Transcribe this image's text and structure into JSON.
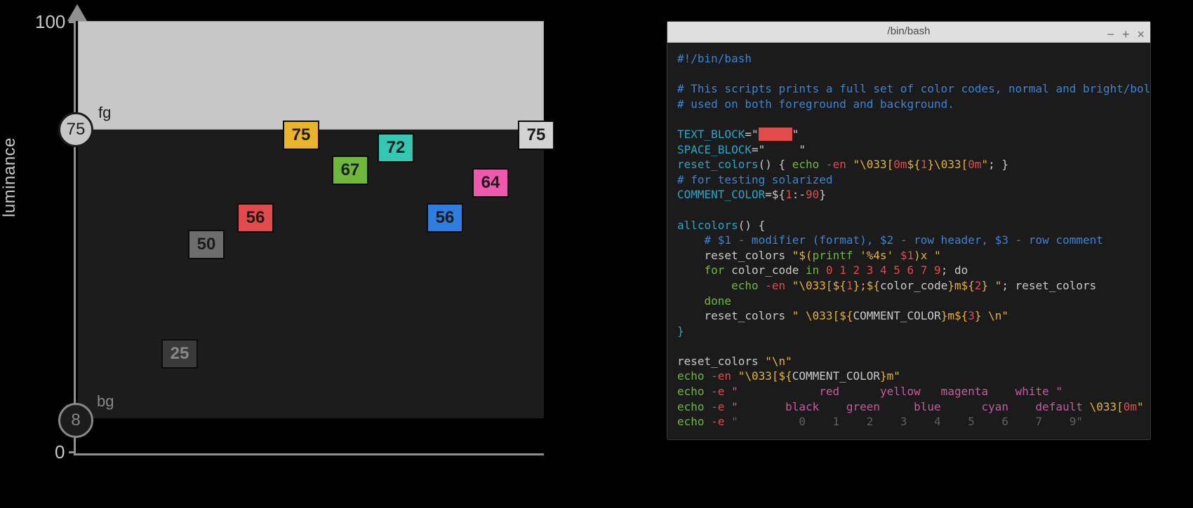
{
  "chart_data": {
    "type": "scatter",
    "title": "",
    "xlabel": "",
    "ylabel": "luminance",
    "ylim": [
      0,
      100
    ],
    "yticks": [
      0,
      100
    ],
    "fg_line": 75,
    "bg_line": 8,
    "points": [
      {
        "label": "25",
        "luminance": 25,
        "color": "#3a3a3a"
      },
      {
        "label": "50",
        "luminance": 50,
        "color": "#6d6d6d"
      },
      {
        "label": "56",
        "luminance": 56,
        "color": "#e24b4b"
      },
      {
        "label": "75",
        "luminance": 75,
        "color": "#e9b42c"
      },
      {
        "label": "67",
        "luminance": 67,
        "color": "#6db83a"
      },
      {
        "label": "72",
        "luminance": 72,
        "color": "#34c7b2"
      },
      {
        "label": "56",
        "luminance": 56,
        "color": "#2f7de0"
      },
      {
        "label": "64",
        "luminance": 64,
        "color": "#ee58ad"
      },
      {
        "label": "75",
        "luminance": 75,
        "color": "#d3d3d3"
      }
    ],
    "axis_labels": {
      "fg": "fg",
      "bg": "bg"
    },
    "axis_circle_values": {
      "fg": "75",
      "bg": "8"
    }
  },
  "terminal": {
    "title": "/bin/bash",
    "win_buttons": {
      "min": "−",
      "max": "+",
      "close": "×"
    },
    "code": {
      "shebang": "#!/bin/bash",
      "blank": "",
      "comment1": "# This scripts prints a full set of color codes, normal and bright/bold,",
      "comment2": "# used on both foreground and background.",
      "textblock_k": "TEXT_BLOCK",
      "textblock_v": "=\"",
      "textblock_fill": "▮▮▮▮▮",
      "textblock_end": "\"",
      "spaceblock_k": "SPACE_BLOCK",
      "spaceblock_v": "=\"     \"",
      "reset_fn": "reset_colors",
      "reset_body_a": "() { ",
      "reset_echo": "echo",
      "reset_flag": " -en ",
      "reset_str_a": "\"\\033[",
      "reset_zero_a": "0m",
      "reset_mid": "${",
      "reset_one": "1",
      "reset_mid2": "}\\033[",
      "reset_zero_b": "0m",
      "reset_str_b": "\"",
      "reset_tail": "; }",
      "comment3": "# for testing solarized",
      "ccolor_k": "COMMENT_COLOR",
      "ccolor_v": "=${",
      "ccolor_one": "1",
      "ccolor_def": ":-",
      "ccolor_num": "90",
      "ccolor_end": "}",
      "all_fn": "allcolors",
      "all_open": "() {",
      "all_c1": "    # $1 - modifier (format), $2 - row header, $3 - row comment",
      "all_l2_a": "    reset_colors ",
      "all_l2_q": "\"$(",
      "all_l2_printf": "printf",
      "all_l2_fmt": " '%4s' ",
      "all_l2_arg": "$1",
      "all_l2_tail": ")x \"",
      "all_for": "    for",
      "all_for_var": " color_code ",
      "all_in": "in",
      "all_nums": " 0 1 2 3 4 5 6 7 9",
      "all_for_tail": "; do",
      "all_echo_ind": "        ",
      "all_echo": "echo",
      "all_echo_flag": " -en ",
      "all_echo_q": "\"\\033[${",
      "all_echo_one": "1",
      "all_echo_mid": "};${",
      "all_echo_cc": "color_code",
      "all_echo_m": "}m${",
      "all_echo_two": "2",
      "all_echo_end": "} \"",
      "all_echo_tail": "; reset_colors",
      "all_done": "    done",
      "all_last_a": "    reset_colors ",
      "all_last_q": "\" \\033[${",
      "all_last_cc": "COMMENT_COLOR",
      "all_last_m": "}m${",
      "all_last_three": "3",
      "all_last_end": "} \\n\"",
      "all_close": "}",
      "foot1_a": "reset_colors ",
      "foot1_q": "\"\\n\"",
      "foot2_echo": "echo",
      "foot2_flag": " -en ",
      "foot2_q": "\"\\033[${",
      "foot2_cc": "COMMENT_COLOR",
      "foot2_end": "}m\"",
      "foot3_echo": "echo",
      "foot3_flag": " -e ",
      "foot3_q": "\"            red      yellow   magenta    white \"",
      "foot4_echo": "echo",
      "foot4_flag": " -e ",
      "foot4_q": "\"       black    green     blue      cyan    default ",
      "foot4_esc": "\\033[",
      "foot4_zero": "0m",
      "foot4_end": "\"",
      "foot5_echo": "echo",
      "foot5_flag": " -e ",
      "foot5_q": "\"         0    1    2    3    4    5    6    7    9\""
    }
  }
}
